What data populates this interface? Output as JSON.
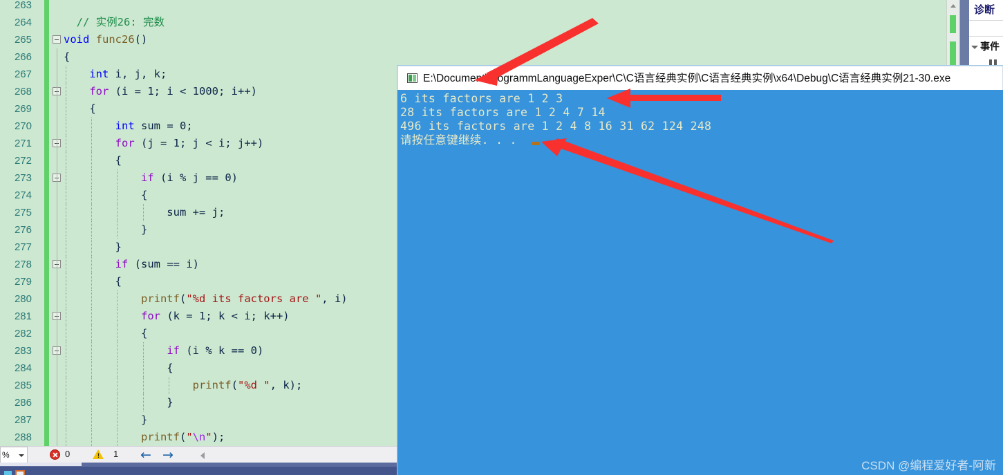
{
  "editor": {
    "first_line": 263,
    "lines": [
      {
        "n": 263,
        "indent": 0,
        "segments": []
      },
      {
        "n": 264,
        "indent": 0,
        "segments": [
          {
            "t": "  // 实例26: 完数",
            "c": "c-com"
          }
        ]
      },
      {
        "n": 265,
        "fold": true,
        "segments": [
          {
            "t": "void ",
            "c": "c-kw"
          },
          {
            "t": "func26",
            "c": "c-fn"
          },
          {
            "t": "()",
            "c": "c-plain"
          }
        ]
      },
      {
        "n": 266,
        "segments": [
          {
            "t": "{",
            "c": "c-plain"
          }
        ]
      },
      {
        "n": 267,
        "segments": [
          {
            "t": "    ",
            "c": "c-plain"
          },
          {
            "t": "int",
            "c": "c-kw"
          },
          {
            "t": " i, j, k;",
            "c": "c-plain"
          }
        ]
      },
      {
        "n": 268,
        "fold": true,
        "segments": [
          {
            "t": "    ",
            "c": "c-plain"
          },
          {
            "t": "for",
            "c": "c-ctrl"
          },
          {
            "t": " (i = ",
            "c": "c-plain"
          },
          {
            "t": "1",
            "c": "c-num"
          },
          {
            "t": "; i < ",
            "c": "c-plain"
          },
          {
            "t": "1000",
            "c": "c-num"
          },
          {
            "t": "; i++)",
            "c": "c-plain"
          }
        ]
      },
      {
        "n": 269,
        "segments": [
          {
            "t": "    {",
            "c": "c-plain"
          }
        ]
      },
      {
        "n": 270,
        "segments": [
          {
            "t": "        ",
            "c": "c-plain"
          },
          {
            "t": "int",
            "c": "c-kw"
          },
          {
            "t": " sum = ",
            "c": "c-plain"
          },
          {
            "t": "0",
            "c": "c-num"
          },
          {
            "t": ";",
            "c": "c-plain"
          }
        ]
      },
      {
        "n": 271,
        "fold": true,
        "segments": [
          {
            "t": "        ",
            "c": "c-plain"
          },
          {
            "t": "for",
            "c": "c-ctrl"
          },
          {
            "t": " (j = ",
            "c": "c-plain"
          },
          {
            "t": "1",
            "c": "c-num"
          },
          {
            "t": "; j < i; j++)",
            "c": "c-plain"
          }
        ]
      },
      {
        "n": 272,
        "segments": [
          {
            "t": "        {",
            "c": "c-plain"
          }
        ]
      },
      {
        "n": 273,
        "fold": true,
        "segments": [
          {
            "t": "            ",
            "c": "c-plain"
          },
          {
            "t": "if",
            "c": "c-ctrl"
          },
          {
            "t": " (i % j == ",
            "c": "c-plain"
          },
          {
            "t": "0",
            "c": "c-num"
          },
          {
            "t": ")",
            "c": "c-plain"
          }
        ]
      },
      {
        "n": 274,
        "segments": [
          {
            "t": "            {",
            "c": "c-plain"
          }
        ]
      },
      {
        "n": 275,
        "segments": [
          {
            "t": "                sum += j;",
            "c": "c-plain"
          }
        ]
      },
      {
        "n": 276,
        "segments": [
          {
            "t": "            }",
            "c": "c-plain"
          }
        ]
      },
      {
        "n": 277,
        "segments": [
          {
            "t": "        }",
            "c": "c-plain"
          }
        ]
      },
      {
        "n": 278,
        "fold": true,
        "segments": [
          {
            "t": "        ",
            "c": "c-plain"
          },
          {
            "t": "if",
            "c": "c-ctrl"
          },
          {
            "t": " (sum == i)",
            "c": "c-plain"
          }
        ]
      },
      {
        "n": 279,
        "segments": [
          {
            "t": "        {",
            "c": "c-plain"
          }
        ]
      },
      {
        "n": 280,
        "segments": [
          {
            "t": "            ",
            "c": "c-plain"
          },
          {
            "t": "printf",
            "c": "c-fn"
          },
          {
            "t": "(",
            "c": "c-plain"
          },
          {
            "t": "\"%d its factors are \"",
            "c": "c-str"
          },
          {
            "t": ", i)",
            "c": "c-plain"
          }
        ]
      },
      {
        "n": 281,
        "fold": true,
        "segments": [
          {
            "t": "            ",
            "c": "c-plain"
          },
          {
            "t": "for",
            "c": "c-ctrl"
          },
          {
            "t": " (k = ",
            "c": "c-plain"
          },
          {
            "t": "1",
            "c": "c-num"
          },
          {
            "t": "; k < i; k++)",
            "c": "c-plain"
          }
        ]
      },
      {
        "n": 282,
        "segments": [
          {
            "t": "            {",
            "c": "c-plain"
          }
        ]
      },
      {
        "n": 283,
        "fold": true,
        "segments": [
          {
            "t": "                ",
            "c": "c-plain"
          },
          {
            "t": "if",
            "c": "c-ctrl"
          },
          {
            "t": " (i % k == ",
            "c": "c-plain"
          },
          {
            "t": "0",
            "c": "c-num"
          },
          {
            "t": ")",
            "c": "c-plain"
          }
        ]
      },
      {
        "n": 284,
        "segments": [
          {
            "t": "                {",
            "c": "c-plain"
          }
        ]
      },
      {
        "n": 285,
        "segments": [
          {
            "t": "                    ",
            "c": "c-plain"
          },
          {
            "t": "printf",
            "c": "c-fn"
          },
          {
            "t": "(",
            "c": "c-plain"
          },
          {
            "t": "\"%d \"",
            "c": "c-str"
          },
          {
            "t": ", k);",
            "c": "c-plain"
          }
        ]
      },
      {
        "n": 286,
        "segments": [
          {
            "t": "                }",
            "c": "c-plain"
          }
        ]
      },
      {
        "n": 287,
        "segments": [
          {
            "t": "            }",
            "c": "c-plain"
          }
        ]
      },
      {
        "n": 288,
        "segments": [
          {
            "t": "            ",
            "c": "c-plain"
          },
          {
            "t": "printf",
            "c": "c-fn"
          },
          {
            "t": "(",
            "c": "c-plain"
          },
          {
            "t": "\"",
            "c": "c-str"
          },
          {
            "t": "\\n",
            "c": "c-esc"
          },
          {
            "t": "\"",
            "c": "c-str"
          },
          {
            "t": ");",
            "c": "c-plain"
          }
        ]
      }
    ]
  },
  "right_dock": {
    "title": "诊断",
    "section_label": "事件",
    "pause_label": "pause"
  },
  "statusbar": {
    "zoom_value": "%",
    "error_count": "0",
    "warning_count": "1",
    "back_arrow": "←",
    "forward_arrow": "→"
  },
  "console": {
    "title": "E:\\Document\\programmLanguageExper\\C\\C语言经典实例\\C语言经典实例\\x64\\Debug\\C语言经典实例21-30.exe",
    "lines": [
      "6 its factors are 1 2 3",
      "28 its factors are 1 2 4 7 14",
      "496 its factors are 1 2 4 8 16 31 62 124 248",
      "请按任意键继续. . ."
    ]
  },
  "watermark": "CSDN @编程爱好者-阿新",
  "colors": {
    "editor_bg": "#CDE8D0",
    "console_bg": "#3693DC",
    "console_text": "#E8E9C8",
    "change_bar": "#5FD169",
    "line_number": "#2B7A78",
    "annotation_arrow": "#F8312F",
    "taskbar": "#44558C"
  }
}
